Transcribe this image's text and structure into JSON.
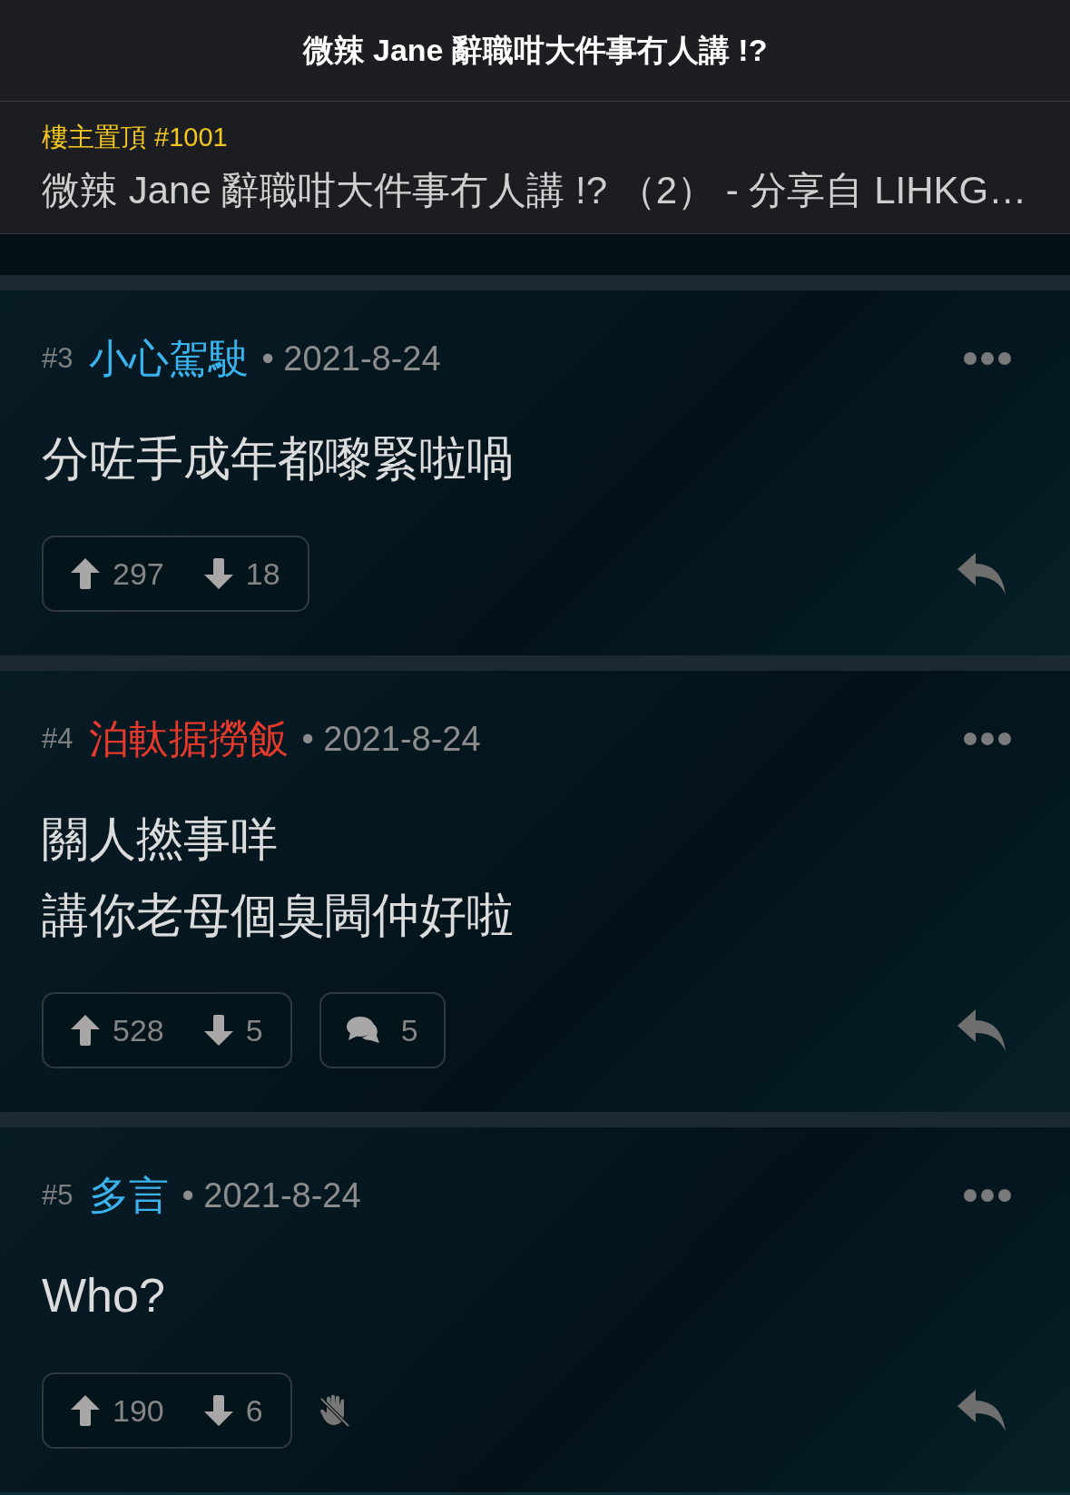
{
  "header": {
    "title": "微辣 Jane 辭職咁大件事冇人講 !?"
  },
  "pinned": {
    "label": "樓主置頂 #1001",
    "text": "微辣 Jane 辭職咁大件事冇人講 !? （2） - 分享自 LIHKG…"
  },
  "posts": [
    {
      "number": "#3",
      "author": "小心駕駛",
      "color": "#3ab4ee",
      "date": "• 2021-8-24",
      "body": [
        "分咗手成年都嚟緊啦喎"
      ],
      "upvotes": "297",
      "downvotes": "18"
    },
    {
      "number": "#4",
      "author": "泊軚据撈飯",
      "color": "#e5392c",
      "date": "• 2021-8-24",
      "body": [
        "關人撚事咩",
        "講你老母個臭閪仲好啦"
      ],
      "upvotes": "528",
      "downvotes": "5",
      "extra": {
        "kind": "replies",
        "count": "5"
      }
    },
    {
      "number": "#5",
      "author": "多言",
      "color": "#3ab4ee",
      "date": "• 2021-8-24",
      "body": [
        "Who?"
      ],
      "upvotes": "190",
      "downvotes": "6",
      "extra": {
        "kind": "blocked"
      }
    }
  ]
}
